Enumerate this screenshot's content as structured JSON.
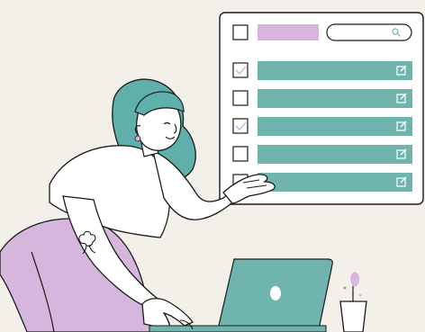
{
  "scene": {
    "background_color": "#f3f0ea",
    "ink_color": "#1a1a1a",
    "hair_color": "#5fb0aa",
    "accent_teal": "#6fb5ae",
    "accent_lavender": "#d6b6dc",
    "skin_color": "#ffffff",
    "pants_color": "#d6b6dc"
  },
  "panel": {
    "search_icon": "search-icon",
    "header_bar_color": "#d6b6dc",
    "row_color": "#6fb5ae",
    "rows": [
      {
        "checked": true,
        "icon": "edit-icon"
      },
      {
        "checked": false,
        "icon": "edit-icon"
      },
      {
        "checked": true,
        "icon": "edit-icon"
      },
      {
        "checked": false,
        "icon": "edit-icon"
      },
      {
        "checked": false,
        "icon": "edit-icon"
      }
    ]
  },
  "laptop": {
    "color": "#6fb5ae",
    "logo_icon": "laptop-logo-icon"
  },
  "plant": {
    "pot_icon": "plant-pot-icon",
    "flower_color": "#d6b6dc"
  },
  "tattoo": {
    "icon": "flower-tattoo-icon"
  }
}
